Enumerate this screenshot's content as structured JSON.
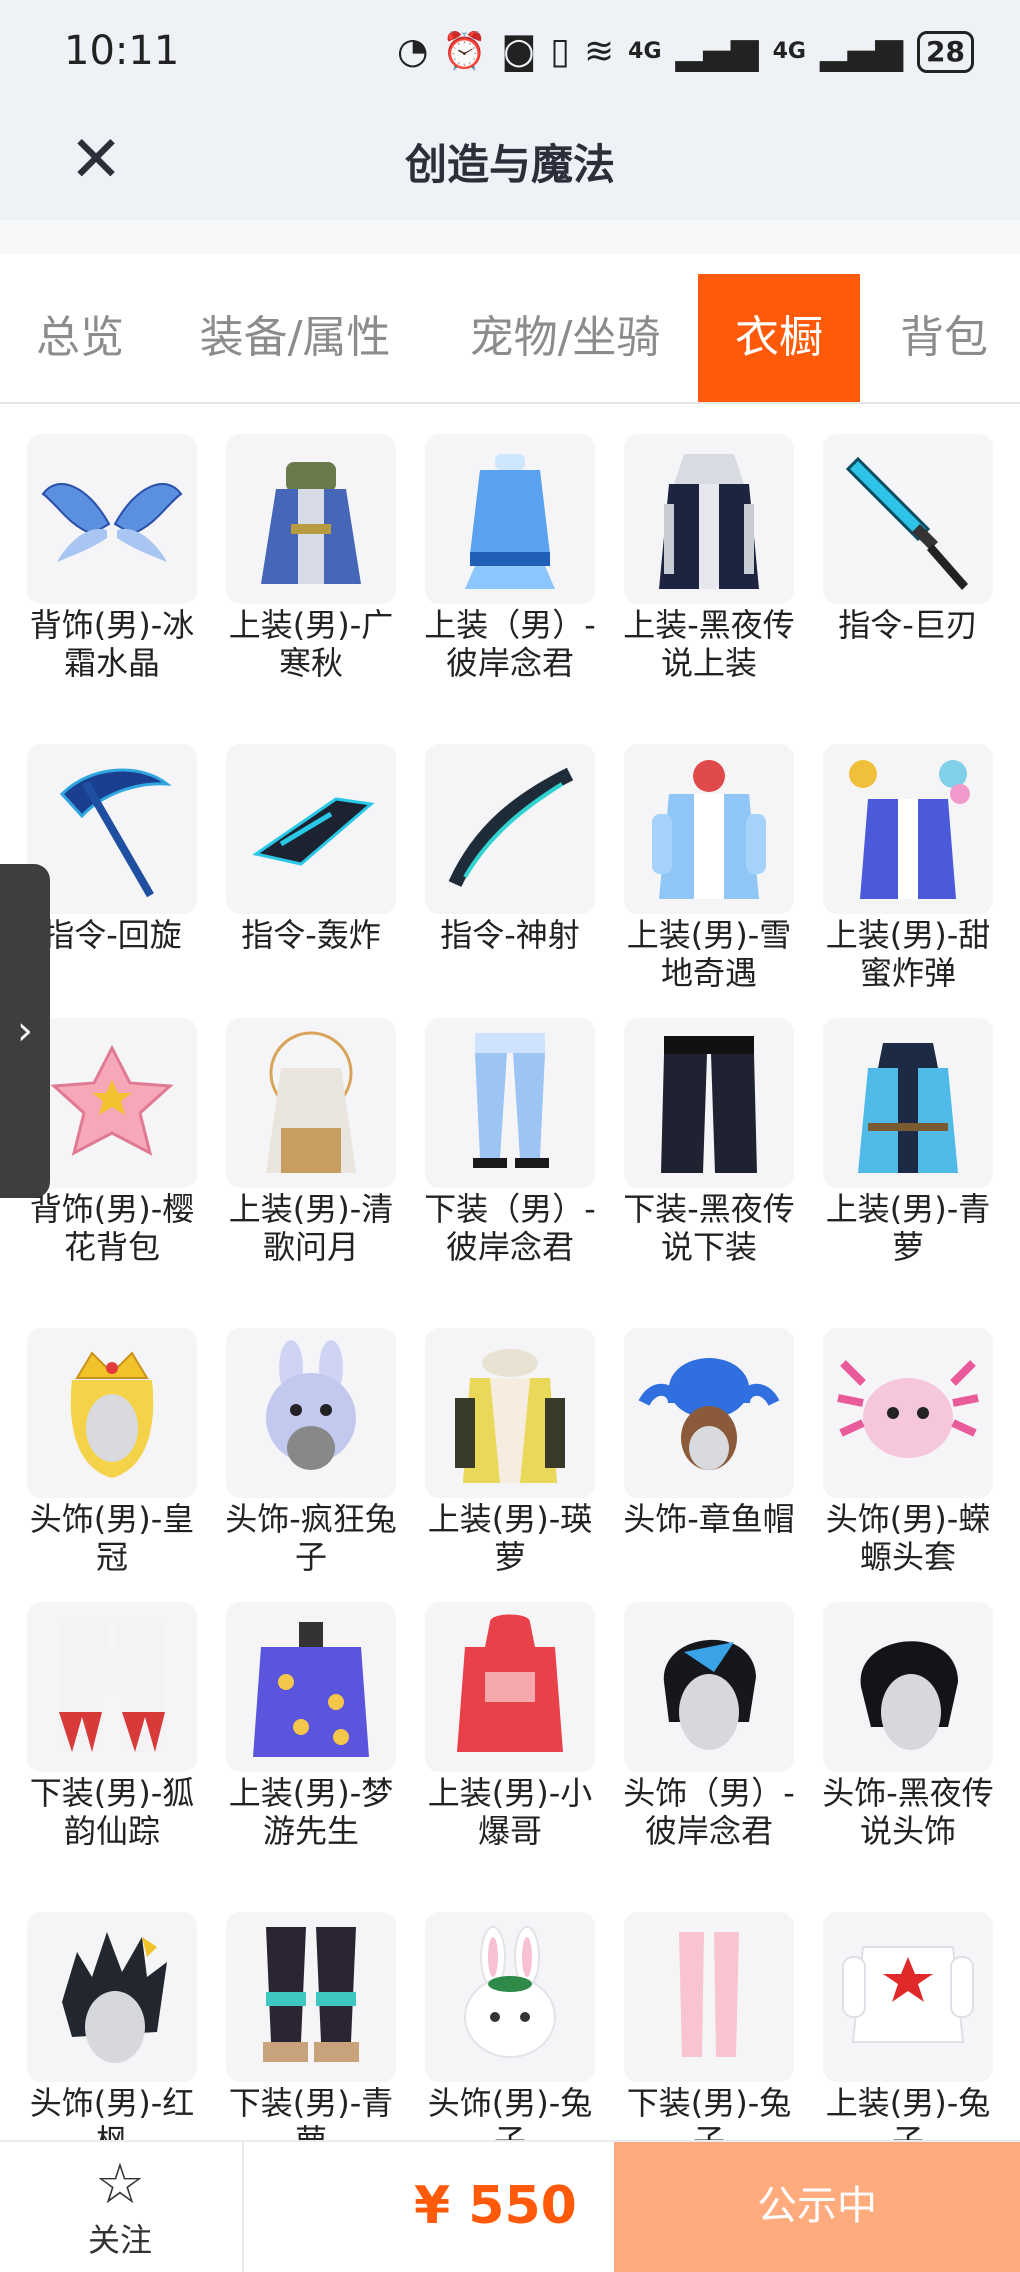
{
  "status_bar": {
    "time": "10:11",
    "net1": "4G",
    "net2": "4G",
    "battery": "28"
  },
  "header": {
    "title": "创造与魔法"
  },
  "tabs": [
    {
      "label": "总览",
      "active": false
    },
    {
      "label": "装备/属性",
      "active": false
    },
    {
      "label": "宠物/坐骑",
      "active": false
    },
    {
      "label": "衣橱",
      "active": true
    },
    {
      "label": "背包",
      "active": false
    }
  ],
  "items": [
    {
      "label": "背饰(男)-冰霜水晶",
      "icon": "ice-wings"
    },
    {
      "label": "上装(男)-广寒秋",
      "icon": "outfit-blue-robe"
    },
    {
      "label": "上装（男）-彼岸念君",
      "icon": "outfit-light-blue"
    },
    {
      "label": "上装-黑夜传说上装",
      "icon": "outfit-dark-coat"
    },
    {
      "label": "指令-巨刃",
      "icon": "sword"
    },
    {
      "label": "指令-回旋",
      "icon": "scythe"
    },
    {
      "label": "指令-轰炸",
      "icon": "blaster"
    },
    {
      "label": "指令-神射",
      "icon": "bow"
    },
    {
      "label": "上装(男)-雪地奇遇",
      "icon": "outfit-snow"
    },
    {
      "label": "上装(男)-甜蜜炸弹",
      "icon": "outfit-sweet"
    },
    {
      "label": "背饰(男)-樱花背包",
      "icon": "sakura-bag"
    },
    {
      "label": "上装(男)-清歌问月",
      "icon": "outfit-moon"
    },
    {
      "label": "下装（男）-彼岸念君",
      "icon": "pants-light-blue"
    },
    {
      "label": "下装-黑夜传说下装",
      "icon": "pants-dark"
    },
    {
      "label": "上装(男)-青萝",
      "icon": "outfit-cyan"
    },
    {
      "label": "头饰(男)-皇冠",
      "icon": "crown"
    },
    {
      "label": "头饰-疯狂兔子",
      "icon": "bunny-hat"
    },
    {
      "label": "上装(男)-瑛萝",
      "icon": "outfit-scarf"
    },
    {
      "label": "头饰-章鱼帽",
      "icon": "octopus-hat"
    },
    {
      "label": "头饰(男)-蝾螈头套",
      "icon": "axolotl-hood"
    },
    {
      "label": "下装(男)-狐韵仙踪",
      "icon": "pants-fox"
    },
    {
      "label": "上装(男)-梦游先生",
      "icon": "outfit-pajama"
    },
    {
      "label": "上装(男)-小爆哥",
      "icon": "red-hoodie"
    },
    {
      "label": "头饰（男）-彼岸念君",
      "icon": "hair-blue-streak"
    },
    {
      "label": "头饰-黑夜传说头饰",
      "icon": "hair-black"
    },
    {
      "label": "头饰(男)-红枫",
      "icon": "hair-spiky"
    },
    {
      "label": "下装(男)-青萝",
      "icon": "boots-cyan"
    },
    {
      "label": "头饰(男)-兔子",
      "icon": "bunny-head"
    },
    {
      "label": "下装(男)-兔子",
      "icon": "pink-legs"
    },
    {
      "label": "上装(男)-兔子",
      "icon": "white-suit-star"
    }
  ],
  "bottom_bar": {
    "follow_label": "关注",
    "price": "¥ 550",
    "status_label": "公示中"
  }
}
